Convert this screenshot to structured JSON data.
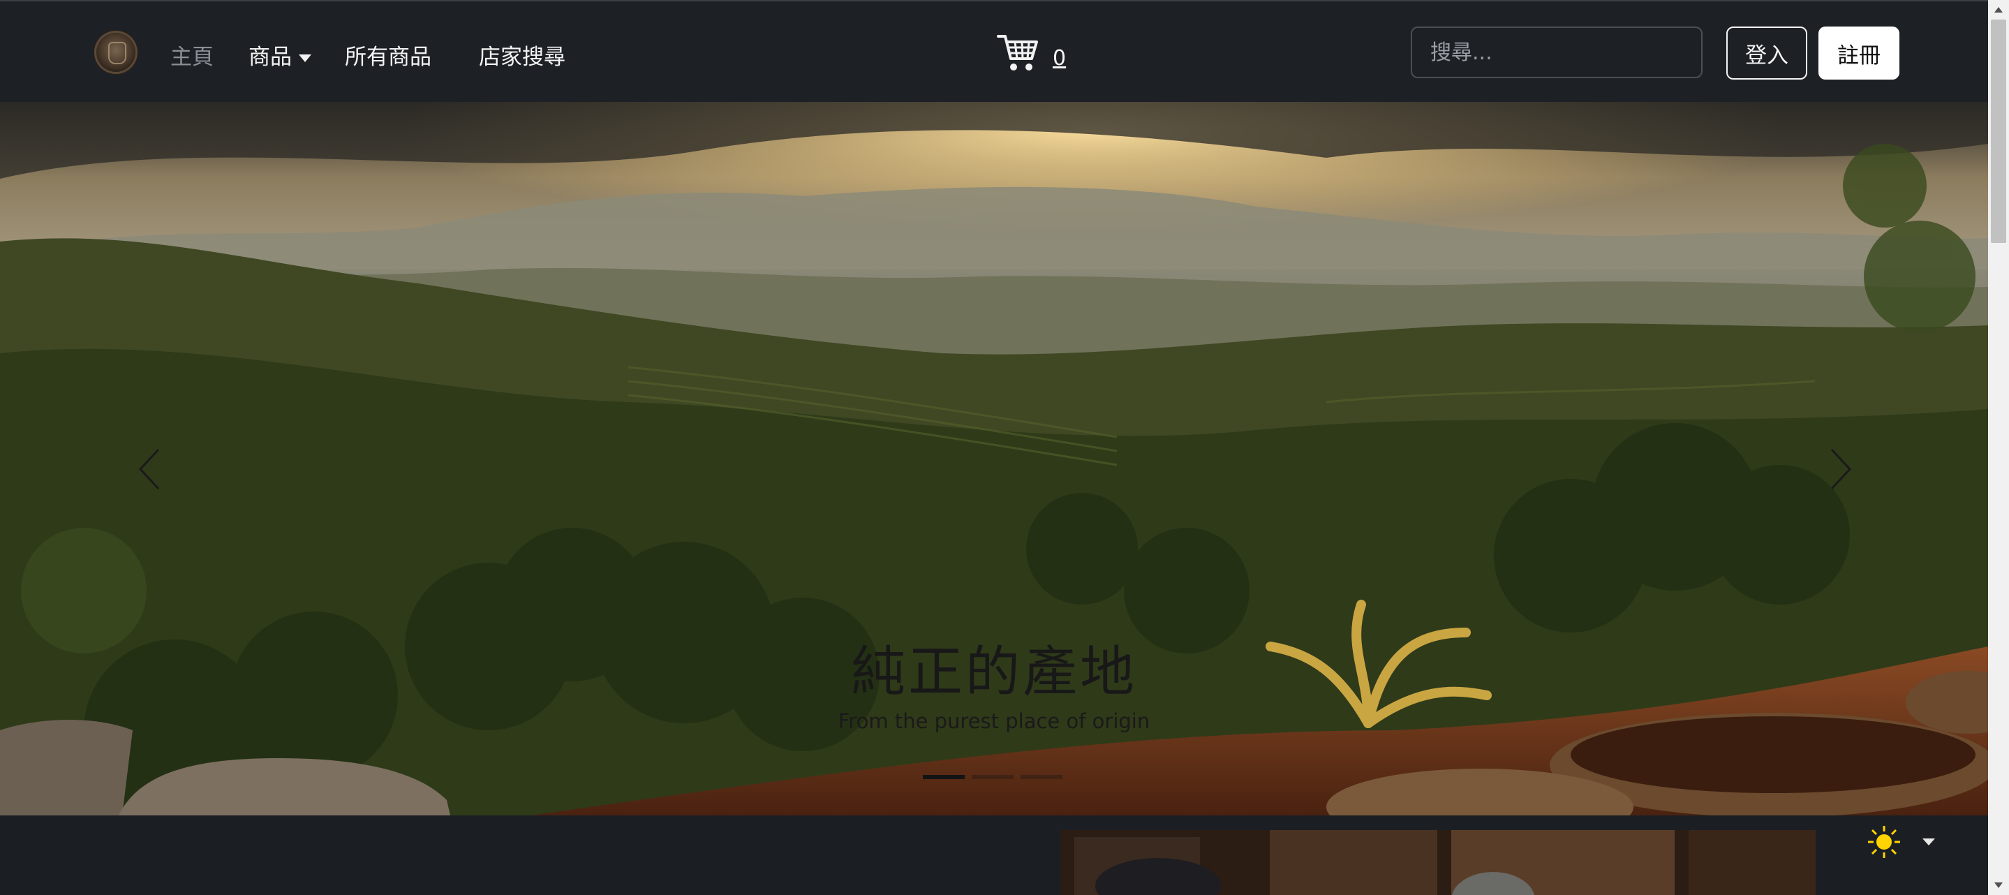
{
  "nav": {
    "logo_icon": "coffee-logo-icon",
    "links": [
      {
        "label": "主頁",
        "active": true
      },
      {
        "label": "商品",
        "has_dropdown": true
      },
      {
        "label": "所有商品"
      },
      {
        "label": "店家搜尋"
      }
    ],
    "cart_icon": "shopping-cart-icon",
    "cart_count": "0",
    "search_placeholder": "搜尋...",
    "search_value": "",
    "login_label": "登入",
    "register_label": "註冊"
  },
  "hero": {
    "title": "純正的產地",
    "subtitle": "From the purest place of origin",
    "slide_count": 3,
    "active_slide": 1,
    "prev_icon": "chevron-left-icon",
    "next_icon": "chevron-right-icon"
  },
  "footer_area": {
    "theme_icon": "sun-icon",
    "theme_caret_icon": "caret-down-icon"
  },
  "colors": {
    "navbar_bg": "#1d2126",
    "page_bg": "#1b1f24",
    "sun_yellow": "#ffd400"
  }
}
